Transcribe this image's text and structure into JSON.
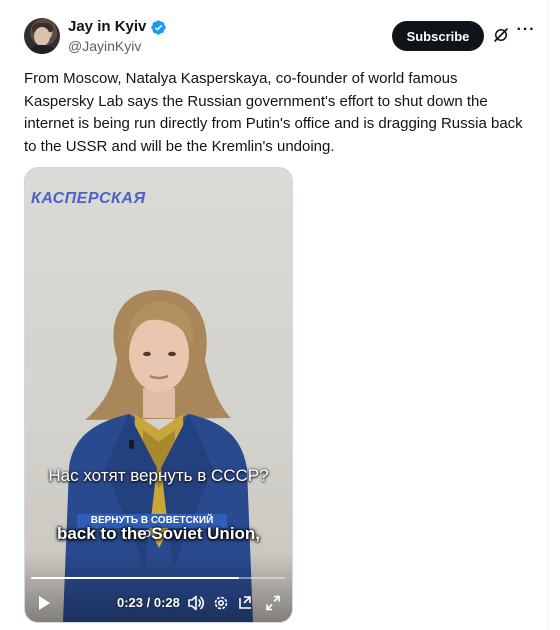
{
  "author": {
    "name": "Jay in Kyiv",
    "handle": "@JayinKyiv",
    "verified": true
  },
  "actions": {
    "subscribe_label": "Subscribe",
    "more_icon": "more-icon",
    "grok_icon": "grok-icon"
  },
  "tweet": {
    "text": "From Moscow, Natalya Kasperskaya, co-founder of world famous Kaspersky Lab says the Russian government's effort to shut down the internet is being run directly from Putin's office and is dragging Russia back to the USSR and will be the Kremlin's undoing."
  },
  "video": {
    "logo_text": "КАСПЕРСКАЯ",
    "caption_ru": "Нас хотят вернуть в СССР?",
    "caption_small": "ВЕРНУТЬ В СОВЕТСКИЙ СОЮЗ",
    "caption_en": "back to the Soviet Union,",
    "time_display": "0:23 / 0:28",
    "progress": 0.82
  },
  "colors": {
    "accent_blue": "#1d9bf0",
    "text": "#0f1419",
    "muted": "#536471",
    "logo_blue": "#4a63c9"
  }
}
